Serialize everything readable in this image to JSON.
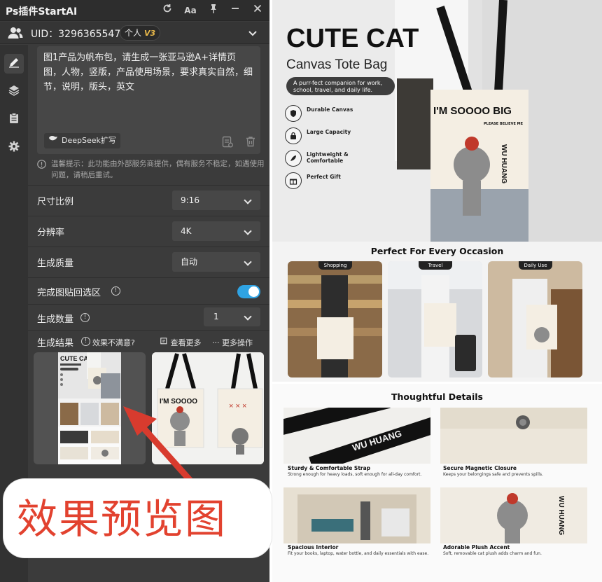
{
  "app": {
    "title": "Ps插件StartAI",
    "font_icon_label": "Aa"
  },
  "user": {
    "uid": "UID：3296365547",
    "plan": "个人",
    "plan_badge": "V3"
  },
  "prompt": {
    "text": "图1产品为帆布包，请生成一张亚马逊A+详情页图，人物，竖版，产品使用场景，要求真实自然，细节，说明，版头，英文",
    "deepseek_label": "DeepSeek扩写"
  },
  "notice": "温馨提示：此功能由外部服务商提供，偶有服务不稳定，如遇使用问题，请稍后重试。",
  "settings": {
    "ratio_label": "尺寸比例",
    "ratio_value": "9:16",
    "resolution_label": "分辨率",
    "resolution_value": "4K",
    "quality_label": "生成质量",
    "quality_value": "自动",
    "paste_back_label": "完成图贴回选区",
    "paste_back_on": true,
    "count_label": "生成数量",
    "count_value": "1"
  },
  "results": {
    "label": "生成结果",
    "unsatisfied": "效果不满意?",
    "view_more": "查看更多",
    "more_actions": "更多操作"
  },
  "annotation": {
    "text": "效果预览图",
    "color": "#e2422f"
  },
  "poster": {
    "title": "CUTE CAT",
    "subtitle": "Canvas Tote Bag",
    "tagline": "A purr-fect companion for work, school, travel, and daily life.",
    "bag_print": "I'M SOOOO BIG",
    "bag_small_print": "PLEASE BELIEVE ME",
    "bag_side_text": "WU HUANG",
    "features": [
      {
        "icon": "shield-icon",
        "text": "Durable Canvas"
      },
      {
        "icon": "lock-icon",
        "text": "Large Capacity"
      },
      {
        "icon": "feather-icon",
        "text": "Lightweight & Comfortable"
      },
      {
        "icon": "gift-icon",
        "text": "Perfect Gift"
      }
    ],
    "occasion_heading": "Perfect For Every Occasion",
    "occasions": [
      "Shopping",
      "Travel",
      "Daily Use"
    ],
    "details_heading": "Thoughtful Details",
    "details": [
      {
        "title": "Sturdy & Comfortable Strap",
        "desc": "Strong enough for heavy loads, soft enough for all-day comfort."
      },
      {
        "title": "Secure Magnetic Closure",
        "desc": "Keeps your belongings safe and prevents spills."
      },
      {
        "title": "Spacious Interior",
        "desc": "Fit your books, laptop, water bottle, and daily essentials with ease."
      },
      {
        "title": "Adorable Plush Accent",
        "desc": "Soft, removable cat plush adds charm and fun."
      }
    ]
  }
}
